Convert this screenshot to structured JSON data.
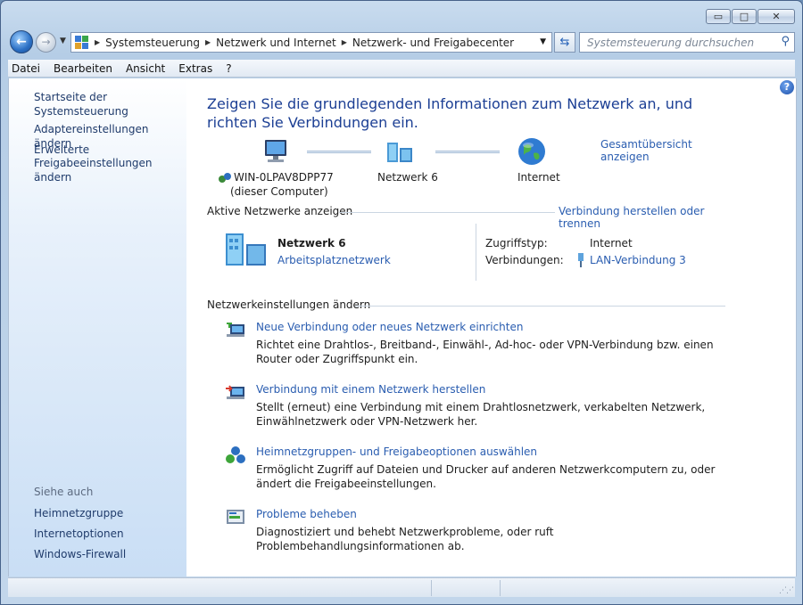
{
  "window": {
    "buttons": {
      "minimize": "▭",
      "maximize": "□",
      "close": "✕"
    }
  },
  "address": {
    "breadcrumbs": [
      "Systemsteuerung",
      "Netzwerk und Internet",
      "Netzwerk- und Freigabecenter"
    ],
    "search_placeholder": "Systemsteuerung durchsuchen"
  },
  "menu": [
    "Datei",
    "Bearbeiten",
    "Ansicht",
    "Extras",
    "?"
  ],
  "sidebar": {
    "links": [
      "Startseite der Systemsteuerung",
      "Adaptereinstellungen ändern",
      "Erweiterte",
      "Freigabeeinstellungen ändern"
    ],
    "see_also_title": "Siehe auch",
    "see_also": [
      "Heimnetzgruppe",
      "Internetoptionen",
      "Windows-Firewall"
    ]
  },
  "main": {
    "title": "Zeigen Sie die grundlegenden Informationen zum Netzwerk an, und richten Sie Verbindungen ein.",
    "full_map_link": "Gesamtübersicht anzeigen",
    "map": {
      "computer_name": "WIN-0LPAV8DPP77",
      "computer_sub": "(dieser Computer)",
      "network": "Netzwerk  6",
      "internet": "Internet"
    },
    "active_networks": {
      "heading": "Aktive Netzwerke anzeigen",
      "connect_link": "Verbindung herstellen oder trennen",
      "network_name": "Netzwerk  6",
      "network_type": "Arbeitsplatznetzwerk",
      "access_type_label": "Zugriffstyp:",
      "access_type_value": "Internet",
      "connections_label": "Verbindungen:",
      "connections_value": "LAN-Verbindung 3"
    },
    "settings": {
      "heading": "Netzwerkeinstellungen ändern",
      "tasks": [
        {
          "title": "Neue Verbindung oder neues Netzwerk einrichten",
          "desc": "Richtet eine Drahtlos-, Breitband-, Einwähl-, Ad-hoc- oder VPN-Verbindung bzw. einen Router oder Zugriffspunkt ein.",
          "icon": "new-connection-icon"
        },
        {
          "title": "Verbindung mit einem Netzwerk herstellen",
          "desc": "Stellt (erneut) eine Verbindung mit einem Drahtlosnetzwerk, verkabelten Netzwerk, Einwählnetzwerk oder VPN-Netzwerk her.",
          "icon": "connect-network-icon"
        },
        {
          "title": "Heimnetzgruppen- und Freigabeoptionen auswählen",
          "desc": "Ermöglicht Zugriff auf Dateien und Drucker auf anderen Netzwerkcomputern zu, oder ändert die Freigabeeinstellungen.",
          "icon": "homegroup-icon"
        },
        {
          "title": "Probleme beheben",
          "desc": "Diagnostiziert und behebt Netzwerkprobleme, oder ruft Problembehandlungsinformationen ab.",
          "icon": "troubleshoot-icon"
        }
      ]
    }
  }
}
